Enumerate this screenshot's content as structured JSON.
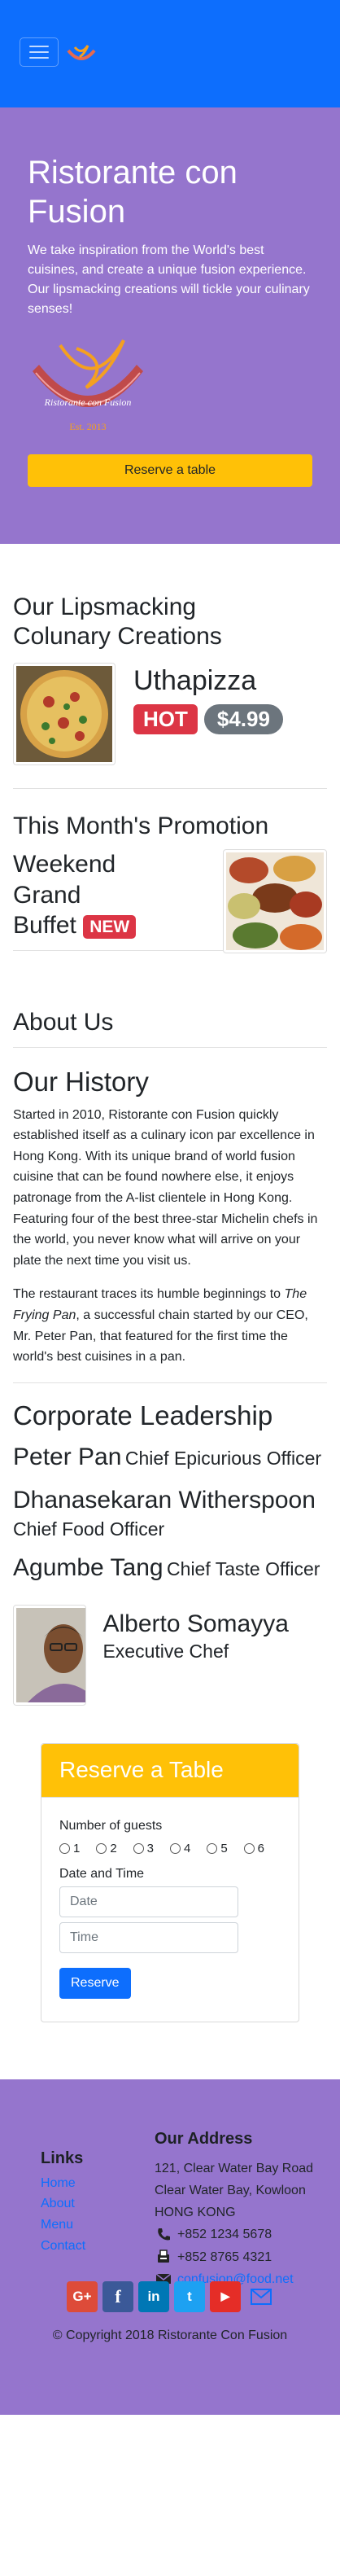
{
  "navbar": {
    "toggler_icon": "hamburger-menu-icon",
    "logo_icon": "restaurant-logo-icon"
  },
  "jumbotron": {
    "title": "Ristorante con Fusion",
    "description": "We take inspiration from the World's best cuisines, and create a unique fusion experience. Our lipsmacking creations will tickle your culinary senses!",
    "logo_text": "Ristorante con Fusion",
    "logo_est": "Est. 2013",
    "reserve_button": "Reserve a table"
  },
  "dishes": {
    "heading_line1": "Our Lipsmacking",
    "heading_line2": "Colunary Creations",
    "dish_name": "Uthapizza",
    "badge_hot": "HOT",
    "price": "$4.99"
  },
  "promotion": {
    "heading": "This Month's Promotion",
    "title_line1": "Weekend",
    "title_line2": "Grand",
    "title_line3": "Buffet",
    "badge_new": "NEW"
  },
  "about": {
    "heading": "About Us",
    "history_heading": "Our History",
    "para1": "Started in 2010, Ristorante con Fusion quickly established itself as a culinary icon par excellence in Hong Kong. With its unique brand of world fusion cuisine that can be found nowhere else, it enjoys patronage from the A-list clientele in Hong Kong. Featuring four of the best three-star Michelin chefs in the world, you never know what will arrive on your plate the next time you visit us.",
    "para2_before": "The restaurant traces its humble beginnings to ",
    "para2_em": "The Frying Pan",
    "para2_after": ", a successful chain started by our CEO, Mr. Peter Pan, that featured for the first time the world's best cuisines in a pan."
  },
  "leadership": {
    "heading": "Corporate Leadership",
    "leaders": [
      {
        "name": "Peter Pan",
        "role": "Chief Epicurious Officer"
      },
      {
        "name": "Dhanasekaran Witherspoon",
        "role": "Chief Food Officer"
      },
      {
        "name": "Agumbe Tang",
        "role": "Chief Taste Officer"
      }
    ],
    "featured": {
      "name": "Alberto Somayya",
      "role": "Executive Chef"
    }
  },
  "reserve_card": {
    "title": "Reserve a Table",
    "guests_label": "Number of guests",
    "guest_options": [
      "1",
      "2",
      "3",
      "4",
      "5",
      "6"
    ],
    "datetime_label": "Date and Time",
    "date_placeholder": "Date",
    "time_placeholder": "Time",
    "submit": "Reserve"
  },
  "footer": {
    "links_heading": "Links",
    "links": [
      "Home",
      "About",
      "Menu",
      "Contact"
    ],
    "address_heading": "Our Address",
    "address_lines": [
      "121, Clear Water Bay Road",
      "Clear Water Bay, Kowloon",
      "HONG KONG"
    ],
    "phone": "+852 1234 5678",
    "fax": "+852 8765 4321",
    "email": "confusion@food.net",
    "social": [
      {
        "icon": "google-plus-icon",
        "label": "G+",
        "color": "#dd4b39"
      },
      {
        "icon": "facebook-icon",
        "label": "f",
        "color": "#3b5998"
      },
      {
        "icon": "linkedin-icon",
        "label": "in",
        "color": "#0077b5"
      },
      {
        "icon": "twitter-icon",
        "label": "t",
        "color": "#1da1f2"
      },
      {
        "icon": "youtube-icon",
        "label": "▶",
        "color": "#e52d27"
      }
    ],
    "mail_icon": "envelope-icon",
    "copyright": "© Copyright 2018 Ristorante Con Fusion"
  },
  "colors": {
    "navbar": "#0d6efd",
    "primary_purple": "#9575cd",
    "accent_yellow": "#ffc107",
    "badge_red": "#dc3545",
    "badge_gray": "#6c757d"
  }
}
